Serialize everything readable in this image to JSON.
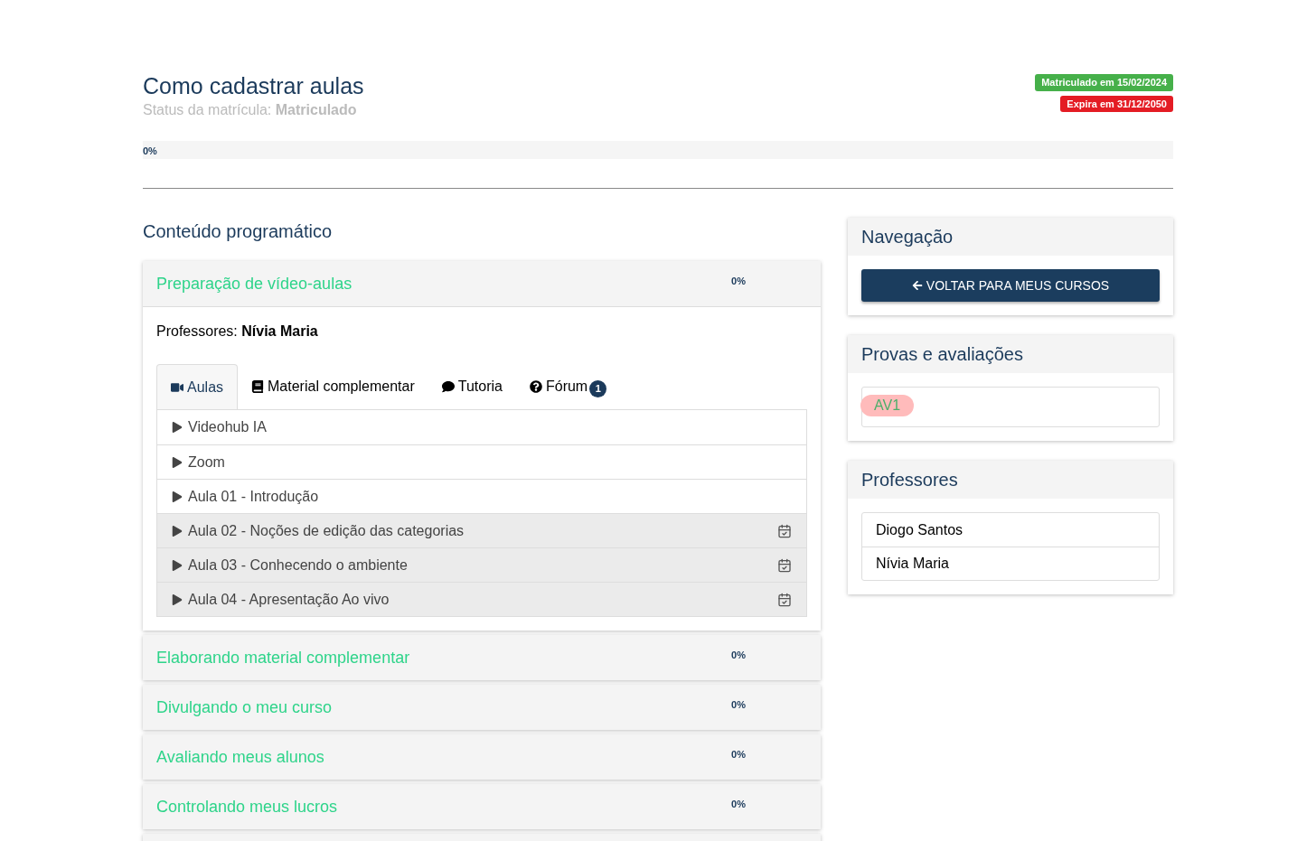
{
  "course": {
    "title": "Como cadastrar aulas",
    "status_label": "Status da matrícula:",
    "status_value": "Matriculado",
    "badges": [
      {
        "text": "Matriculado em 15/02/2024",
        "color": "#46b04a"
      },
      {
        "text": "Expira em 31/12/2050",
        "color": "#e41c24"
      }
    ],
    "progress": {
      "level": 0,
      "reading": "0%"
    }
  },
  "content": {
    "heading": "Conteúdo programático",
    "modules": [
      {
        "title": "Preparação de vídeo-aulas",
        "percent": "0%",
        "expanded": true,
        "teachers_label": "Professores:",
        "teachers": "Nívia Maria",
        "tabs": [
          {
            "label": "Aulas",
            "selected": true
          },
          {
            "label": "Material complementar",
            "selected": false
          },
          {
            "label": "Tutoria",
            "selected": false
          },
          {
            "label": "Fórum",
            "selected": false,
            "badge": "1"
          }
        ],
        "lessons": [
          {
            "title": "Videohub IA",
            "scheduled": false
          },
          {
            "title": "Zoom",
            "scheduled": false
          },
          {
            "title": "Aula 01 - Introdução",
            "scheduled": false
          },
          {
            "title": "Aula 02 - Noções de edição das categorias",
            "scheduled": true
          },
          {
            "title": "Aula 03 - Conhecendo o ambiente",
            "scheduled": true
          },
          {
            "title": "Aula 04 - Apresentação Ao vivo",
            "scheduled": true
          }
        ]
      },
      {
        "title": "Elaborando material complementar",
        "percent": "0%",
        "expanded": false
      },
      {
        "title": "Divulgando o meu curso",
        "percent": "0%",
        "expanded": false
      },
      {
        "title": "Avaliando meus alunos",
        "percent": "0%",
        "expanded": false
      },
      {
        "title": "Controlando meus lucros",
        "percent": "0%",
        "expanded": false
      }
    ]
  },
  "sidebar": {
    "navigation": {
      "title": "Navegação",
      "button": "VOLTAR PARA MEUS CURSOS"
    },
    "exams": {
      "title": "Provas e avaliações",
      "items": [
        "AV1"
      ]
    },
    "teachers": {
      "title": "Professores",
      "items": [
        "Diogo Santos",
        "Nívia Maria"
      ]
    }
  }
}
